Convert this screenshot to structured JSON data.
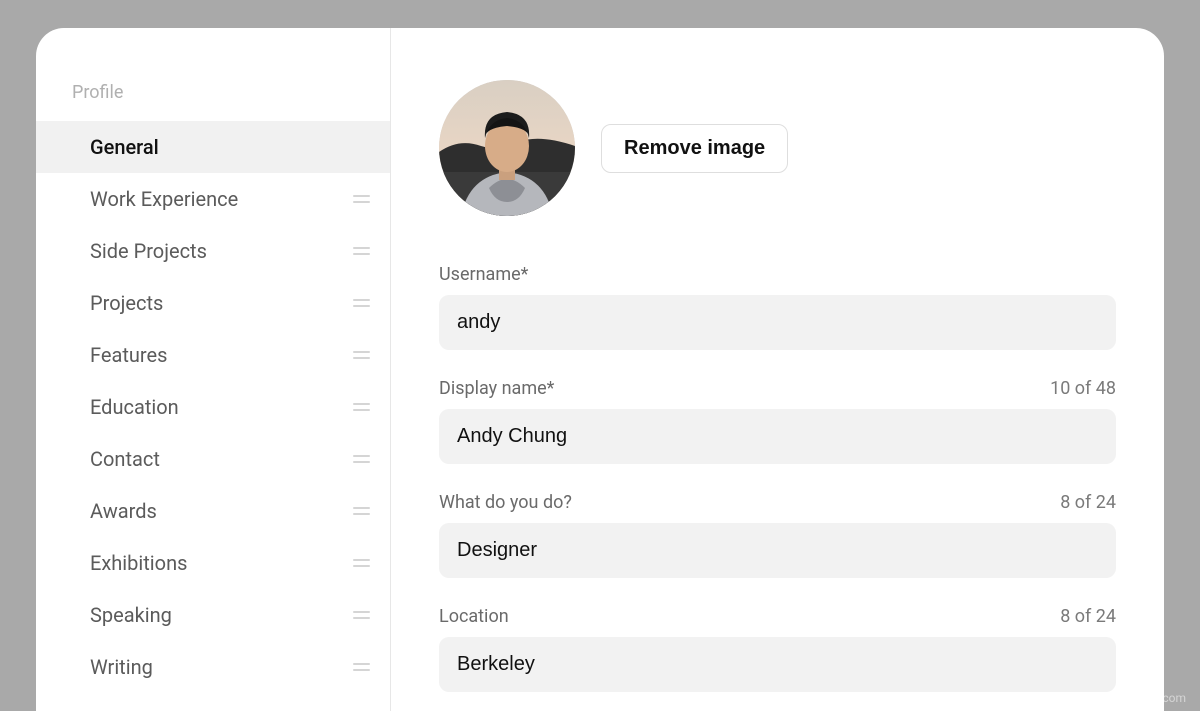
{
  "sidebar": {
    "title": "Profile",
    "items": [
      {
        "label": "General",
        "active": true,
        "showDrag": false
      },
      {
        "label": "Work Experience",
        "active": false,
        "showDrag": true
      },
      {
        "label": "Side Projects",
        "active": false,
        "showDrag": true
      },
      {
        "label": "Projects",
        "active": false,
        "showDrag": true
      },
      {
        "label": "Features",
        "active": false,
        "showDrag": true
      },
      {
        "label": "Education",
        "active": false,
        "showDrag": true
      },
      {
        "label": "Contact",
        "active": false,
        "showDrag": true
      },
      {
        "label": "Awards",
        "active": false,
        "showDrag": true
      },
      {
        "label": "Exhibitions",
        "active": false,
        "showDrag": true
      },
      {
        "label": "Speaking",
        "active": false,
        "showDrag": true
      },
      {
        "label": "Writing",
        "active": false,
        "showDrag": true
      }
    ]
  },
  "main": {
    "remove_image_label": "Remove image",
    "fields": {
      "username": {
        "label": "Username*",
        "value": "andy",
        "counter": ""
      },
      "display_name": {
        "label": "Display name*",
        "value": "Andy Chung",
        "counter": "10 of 48"
      },
      "what_do_you_do": {
        "label": "What do you do?",
        "value": "Designer",
        "counter": "8 of 24"
      },
      "location": {
        "label": "Location",
        "value": "Berkeley",
        "counter": "8 of 24"
      }
    }
  },
  "watermark": "www.ifanr.com"
}
